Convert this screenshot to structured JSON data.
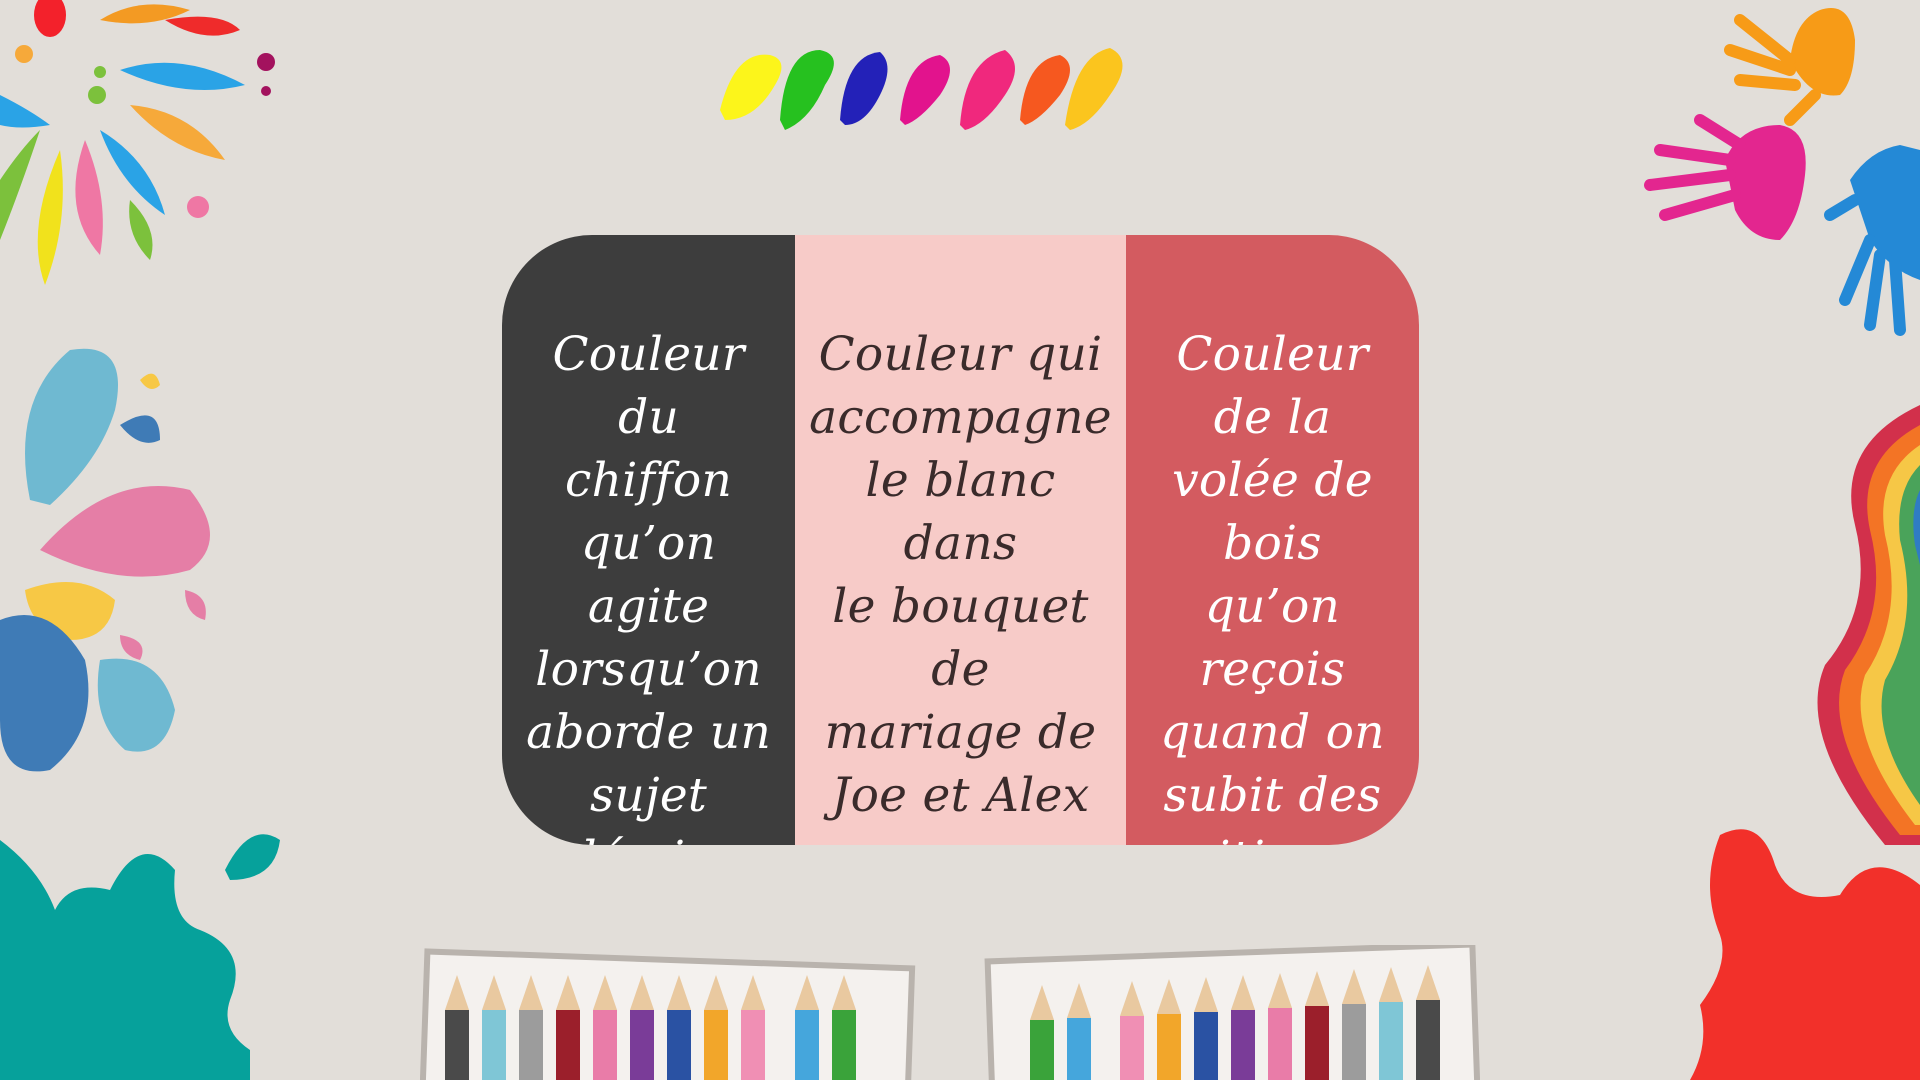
{
  "card": {
    "columns": [
      {
        "text": "Couleur du\nchiffon qu’on\nagite\nlorsqu’on\naborde un\nsujet\npolémique",
        "color": "#3d3d3d"
      },
      {
        "text": "Couleur qui\naccompagne\nle blanc dans\nle bouquet de\nmariage de\nJoe et Alex",
        "color": "#f7cbc8"
      },
      {
        "text": "Couleur de la\nvolée de bois\nqu’on reçois\nquand on\nsubit des\ncritiques\nviolentes",
        "color": "#d35b60"
      }
    ]
  },
  "decorations": {
    "top_left": "paint-splash-icon",
    "left": "paint-drops-icon",
    "bottom_left": "teal-splat-icon",
    "top_center": "paint-strokes-icon",
    "top_right": "handprints-icon",
    "right": "rainbow-wave-icon",
    "bottom_right": "red-splat-icon",
    "bottom": "colored-pencils-icon"
  }
}
